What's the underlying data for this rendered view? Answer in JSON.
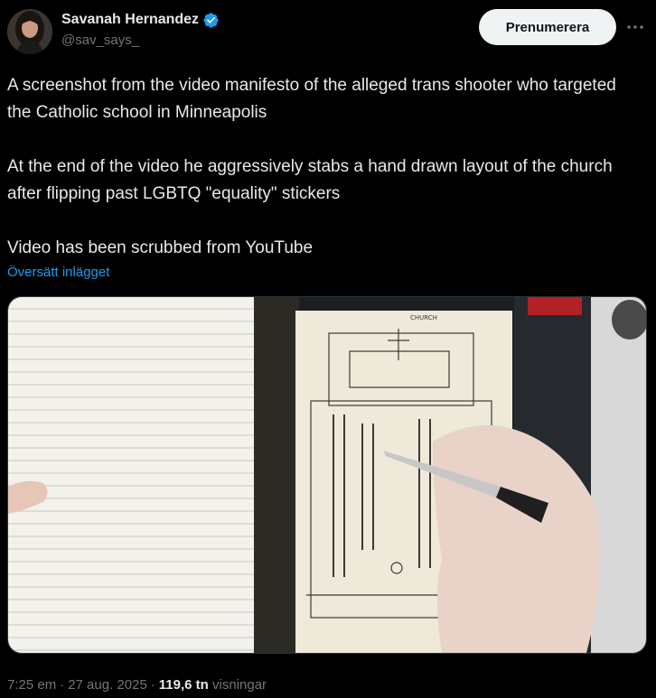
{
  "author": {
    "display_name": "Savanah Hernandez",
    "handle": "@sav_says_",
    "verified": true
  },
  "actions": {
    "subscribe_label": "Prenumerera"
  },
  "tweet": {
    "paragraph_1": "A screenshot from the video manifesto of the alleged trans shooter who targeted the Catholic school in Minneapolis",
    "paragraph_2": "At the end of the video he aggressively stabs a hand drawn layout of the church after flipping past LGBTQ \"equality\" stickers",
    "paragraph_3": "Video has been scrubbed from YouTube",
    "translate_label": "Översätt inlägget"
  },
  "media": {
    "sketch_note": "CHURCH"
  },
  "meta": {
    "time": "7:25 em",
    "date": "27 aug. 2025",
    "views_count": "119,6 tn",
    "views_label": "visningar"
  },
  "colors": {
    "background": "#000000",
    "text": "#e7e9ea",
    "secondary_text": "#71767b",
    "link": "#1d9bf0",
    "verified_badge": "#1d9bf0",
    "button_bg": "#eff3f4"
  }
}
